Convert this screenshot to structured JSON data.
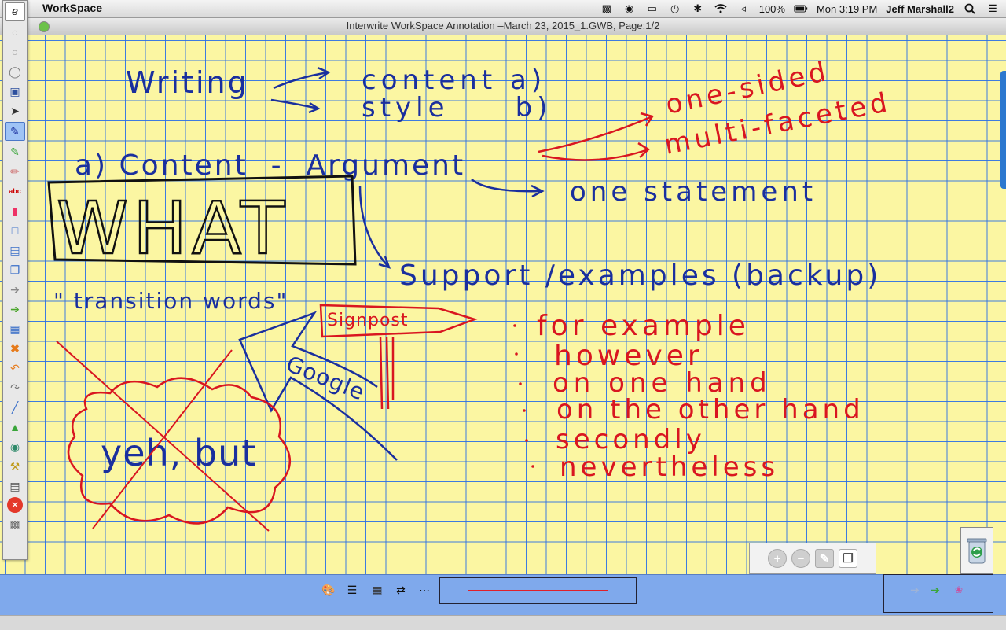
{
  "menubar": {
    "app_name": "WorkSpace",
    "battery": "100%",
    "clock": "Mon 3:19 PM",
    "user": "Jeff Marshall2",
    "icons": [
      "screenshot-icon",
      "camera-icon",
      "airplay-icon",
      "time-machine-icon",
      "bluetooth-icon",
      "wifi-icon",
      "volume-icon",
      "battery-icon",
      "search-icon",
      "menu-list-icon"
    ]
  },
  "window": {
    "title": "Interwrite WorkSpace Annotation –March 23, 2015_1.GWB, Page:1/2"
  },
  "annotations": {
    "line1_left": "Writing",
    "line1_content": "content  a)",
    "line1_style": "style     b)",
    "one_sided": "one-sided",
    "multi_faceted": "multi-faceted",
    "content_arg": "a) Content  -  Argument",
    "one_statement": "one statement",
    "what": "WHAT",
    "support": "Support /examples (backup)",
    "transition": "\" transition words\"",
    "signpost": "Signpost",
    "google": "Google",
    "yeh_but": "yeh, but",
    "transitions_list": [
      "for example",
      "however",
      "on one hand",
      "on the other hand",
      "secondly",
      "nevertheless"
    ]
  },
  "colors": {
    "ink_blue": "#1a2f9e",
    "ink_red": "#d91620",
    "ink_black": "#111111",
    "paper": "#fbf6a2",
    "grid": "#2a6fe0"
  },
  "bottombar": {
    "palette": [
      "#000000",
      "#e0202a",
      "#159b3a",
      "#ffffff",
      "#1e3aa8"
    ]
  }
}
